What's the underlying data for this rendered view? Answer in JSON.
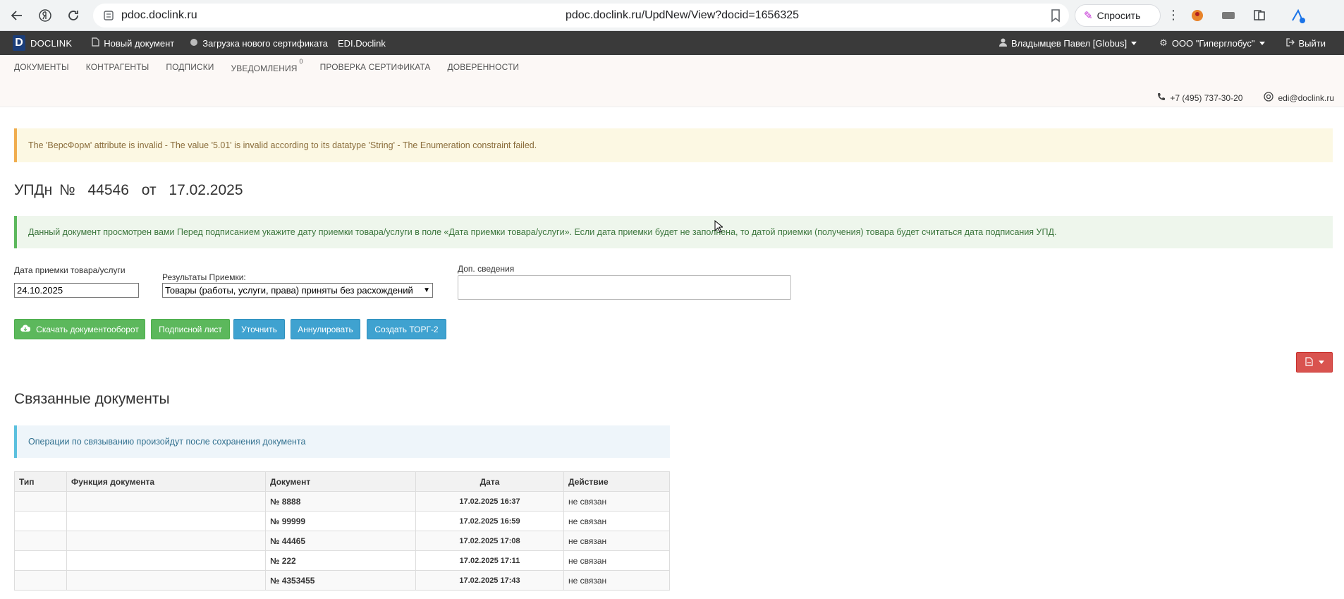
{
  "browser": {
    "host": "pdoc.doclink.ru",
    "url": "pdoc.doclink.ru/UpdNew/View?docid=1656325",
    "ask_label": "Спросить"
  },
  "app_nav": {
    "logo_letter": "D",
    "logo_text": "DOCLINK",
    "items": [
      {
        "label": "Новый документ",
        "icon": "document-icon"
      },
      {
        "label": "Загрузка нового сертификата",
        "icon": "certificate-icon"
      },
      {
        "label": "EDI.Doclink",
        "icon": ""
      }
    ],
    "user": "Владымцев Павел [Globus]",
    "org": "ООО \"Гиперглобус\"",
    "logout": "Выйти"
  },
  "sub_nav": {
    "menu": [
      {
        "label": "ДОКУМЕНТЫ"
      },
      {
        "label": "КОНТРАГЕНТЫ"
      },
      {
        "label": "ПОДПИСКИ"
      },
      {
        "label": "УВЕДОМЛЕНИЯ",
        "badge": "0"
      },
      {
        "label": "ПРОВЕРКА СЕРТИФИКАТА"
      },
      {
        "label": "ДОВЕРЕННОСТИ"
      }
    ],
    "phone": "+7 (495) 737-30-20",
    "email": "edi@doclink.ru"
  },
  "warning_text": "The 'ВерсФорм' attribute is invalid - The value '5.01' is invalid according to its datatype 'String' - The Enumeration constraint failed.",
  "doc_title": {
    "type": "УПДн",
    "num_sign": "№",
    "number": "44546",
    "from": "от",
    "date": "17.02.2025"
  },
  "success_text": "Данный документ просмотрен вами  Перед подписанием укажите дату приемки товара/услуги в поле «Дата приемки товара/услуги». Если дата приемки будет не заполнена, то датой приемки (получения) товара будет считаться дата подписания УПД.",
  "form": {
    "date_label": "Дата приемки товара/услуги",
    "date_value": "24.10.2025",
    "result_label": "Результаты Приемки:",
    "result_value": "Товары (работы, услуги, права) приняты без расхождений",
    "extra_label": "Доп. сведения"
  },
  "buttons": {
    "download": "Скачать документооборот",
    "sign_sheet": "Подписной лист",
    "clarify": "Уточнить",
    "annul": "Аннулировать",
    "torg2": "Создать ТОРГ-2"
  },
  "related": {
    "title": "Связанные документы",
    "info": "Операции по связыванию произойдут после сохранения документа",
    "columns": [
      "Тип",
      "Функция документа",
      "Документ",
      "Дата",
      "Действие"
    ],
    "rows": [
      {
        "type": "",
        "func": "",
        "doc": "№ 8888",
        "date": "17.02.2025 16:37",
        "action": "не связан"
      },
      {
        "type": "",
        "func": "",
        "doc": "№ 99999",
        "date": "17.02.2025 16:59",
        "action": "не связан"
      },
      {
        "type": "",
        "func": "",
        "doc": "№ 44465",
        "date": "17.02.2025 17:08",
        "action": "не связан"
      },
      {
        "type": "",
        "func": "",
        "doc": "№ 222",
        "date": "17.02.2025 17:11",
        "action": "не связан"
      },
      {
        "type": "",
        "func": "",
        "doc": "№ 4353455",
        "date": "17.02.2025 17:43",
        "action": "не связан"
      }
    ]
  }
}
